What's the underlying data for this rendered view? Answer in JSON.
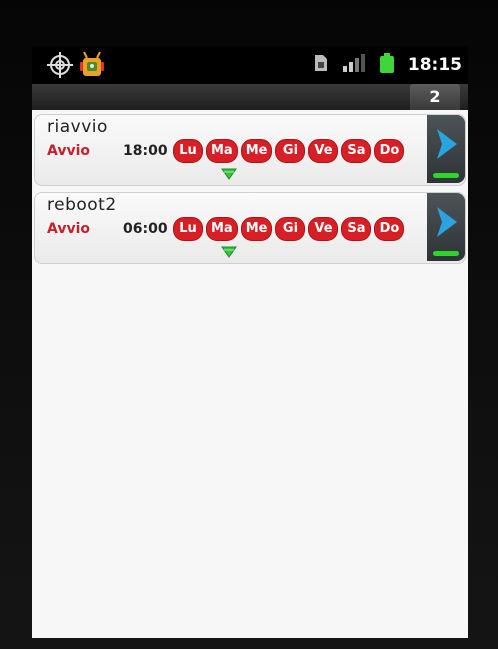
{
  "status_bar": {
    "time": "18:15",
    "icons": [
      "gps-icon",
      "android-robot-icon",
      "sim-card-icon",
      "signal-bars-icon",
      "battery-icon"
    ]
  },
  "tab": {
    "count": "2"
  },
  "alarms": [
    {
      "name": "riavvio",
      "action": "Avvio",
      "time": "18:00",
      "days": [
        "Lu",
        "Ma",
        "Me",
        "Gi",
        "Ve",
        "Sa",
        "Do"
      ]
    },
    {
      "name": "reboot2",
      "action": "Avvio",
      "time": "06:00",
      "days": [
        "Lu",
        "Ma",
        "Me",
        "Gi",
        "Ve",
        "Sa",
        "Do"
      ]
    }
  ],
  "colors": {
    "day_badge": "#d81f26",
    "action_text": "#c8202a",
    "indicator": "#2fd62a",
    "chevron": "#2aa3e0"
  }
}
